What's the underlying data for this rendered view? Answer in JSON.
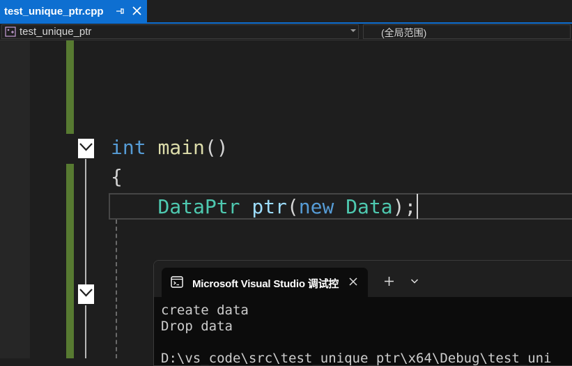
{
  "tab": {
    "title": "test_unique_ptr.cpp"
  },
  "navbar": {
    "scope": "test_unique_ptr",
    "members": "(全局范围)"
  },
  "code": {
    "line1": {
      "kw": "int",
      "fn": "main",
      "rest": "()"
    },
    "line2": "{",
    "line3": {
      "type1": "DataPtr",
      "var": "ptr",
      "p1": "(",
      "kw": "new",
      "type2": "Data",
      "p2": ");"
    }
  },
  "console": {
    "title": "Microsoft Visual Studio 调试控",
    "output": [
      "create data",
      "Drop data",
      "",
      "D:\\vs_code\\src\\test_unique_ptr\\x64\\Debug\\test_uni"
    ]
  },
  "colors": {
    "accent": "#0e6fd1",
    "change_bar": "#577a31",
    "keyword": "#569cd6",
    "function": "#dcdcaa",
    "type": "#4ec9b0",
    "variable": "#9cdcfe"
  },
  "icons": [
    "pin-icon",
    "close-icon",
    "class-scope-icon",
    "dropdown-arrow-icon",
    "fold-collapse-icon",
    "console-app-icon",
    "plus-icon",
    "chevron-down-icon"
  ]
}
